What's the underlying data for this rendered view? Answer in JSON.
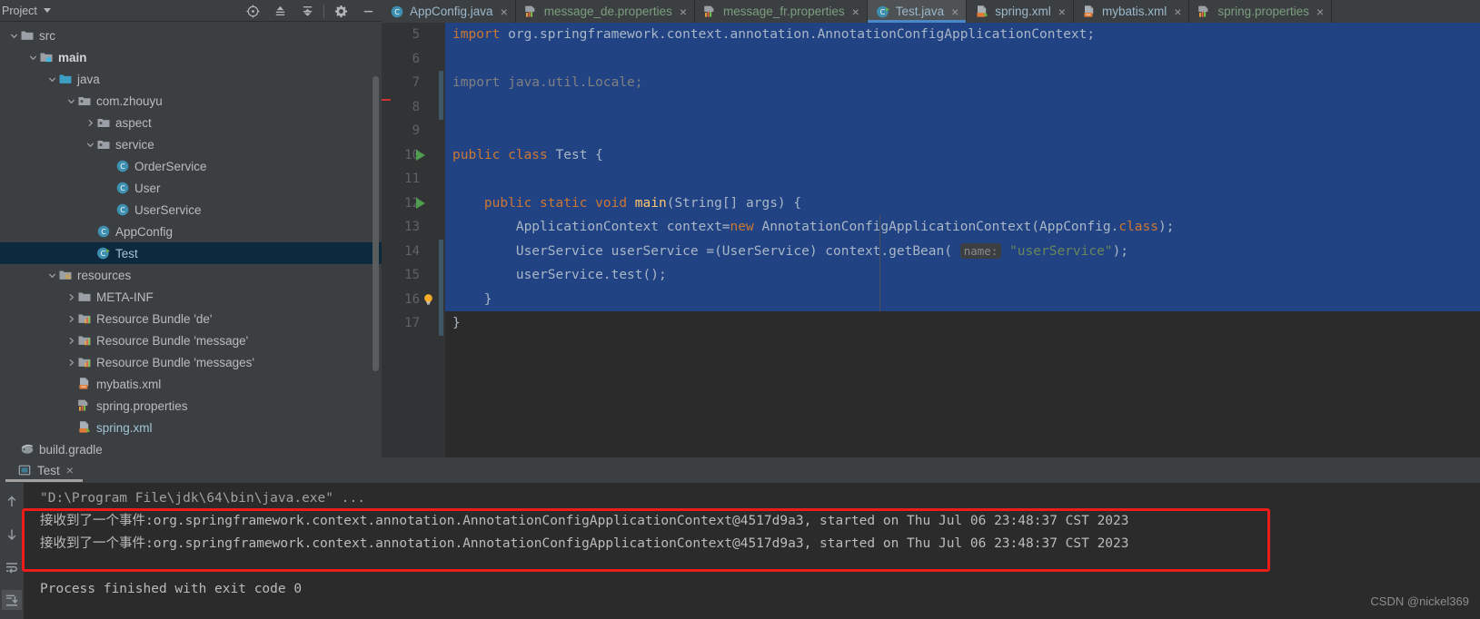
{
  "project_panel": {
    "title": "Project",
    "caret_icon": "chevron-down-icon",
    "toolbar": [
      {
        "name": "locate-target-icon",
        "label": "Select Opened File"
      },
      {
        "name": "expand-all-icon",
        "label": "Expand All"
      },
      {
        "name": "collapse-all-icon",
        "label": "Collapse All"
      },
      {
        "name": "gear-icon",
        "label": "Settings"
      },
      {
        "name": "minimize-icon",
        "label": "Hide"
      }
    ],
    "tree": [
      {
        "label": "src",
        "indent": 0,
        "twisty": "expanded",
        "icon": "folder-icon",
        "style": "normal"
      },
      {
        "label": "main",
        "indent": 1,
        "twisty": "expanded",
        "icon": "module-folder-icon",
        "style": "bold"
      },
      {
        "label": "java",
        "indent": 2,
        "twisty": "expanded",
        "icon": "source-folder-icon",
        "style": "normal"
      },
      {
        "label": "com.zhouyu",
        "indent": 3,
        "twisty": "expanded",
        "icon": "package-icon",
        "style": "normal"
      },
      {
        "label": "aspect",
        "indent": 4,
        "twisty": "collapsed",
        "icon": "package-icon",
        "style": "normal"
      },
      {
        "label": "service",
        "indent": 4,
        "twisty": "expanded",
        "icon": "package-icon",
        "style": "normal"
      },
      {
        "label": "OrderService",
        "indent": 5,
        "twisty": "none",
        "icon": "class-icon",
        "style": "normal"
      },
      {
        "label": "User",
        "indent": 5,
        "twisty": "none",
        "icon": "class-icon",
        "style": "normal"
      },
      {
        "label": "UserService",
        "indent": 5,
        "twisty": "none",
        "icon": "class-icon",
        "style": "normal"
      },
      {
        "label": "AppConfig",
        "indent": 4,
        "twisty": "none",
        "icon": "class-icon",
        "style": "normal"
      },
      {
        "label": "Test",
        "indent": 4,
        "twisty": "none",
        "icon": "runnable-class-icon",
        "style": "selected"
      },
      {
        "label": "resources",
        "indent": 2,
        "twisty": "expanded",
        "icon": "resources-folder-icon",
        "style": "normal"
      },
      {
        "label": "META-INF",
        "indent": 3,
        "twisty": "collapsed",
        "icon": "folder-icon",
        "style": "normal"
      },
      {
        "label": "Resource Bundle 'de'",
        "indent": 3,
        "twisty": "collapsed",
        "icon": "resource-bundle-icon",
        "style": "normal"
      },
      {
        "label": "Resource Bundle 'message'",
        "indent": 3,
        "twisty": "collapsed",
        "icon": "resource-bundle-icon",
        "style": "normal"
      },
      {
        "label": "Resource Bundle 'messages'",
        "indent": 3,
        "twisty": "collapsed",
        "icon": "resource-bundle-icon",
        "style": "normal"
      },
      {
        "label": "mybatis.xml",
        "indent": 3,
        "twisty": "none",
        "icon": "xml-file-icon",
        "style": "normal"
      },
      {
        "label": "spring.properties",
        "indent": 3,
        "twisty": "none",
        "icon": "properties-file-icon",
        "style": "normal"
      },
      {
        "label": "spring.xml",
        "indent": 3,
        "twisty": "none",
        "icon": "spring-xml-icon",
        "style": "open"
      },
      {
        "label": "build.gradle",
        "indent": 0,
        "twisty": "none",
        "icon": "gradle-file-icon",
        "style": "normal"
      }
    ]
  },
  "editor": {
    "tabs": [
      {
        "label": "AppConfig.java",
        "icon": "java-class-icon",
        "active": false,
        "kind": "java"
      },
      {
        "label": "message_de.properties",
        "icon": "properties-file-icon",
        "active": false,
        "kind": "props"
      },
      {
        "label": "message_fr.properties",
        "icon": "properties-file-icon",
        "active": false,
        "kind": "props"
      },
      {
        "label": "Test.java",
        "icon": "runnable-class-icon",
        "active": true,
        "kind": "java"
      },
      {
        "label": "spring.xml",
        "icon": "spring-xml-icon",
        "active": false,
        "kind": "java"
      },
      {
        "label": "mybatis.xml",
        "icon": "xml-file-icon",
        "active": false,
        "kind": "java"
      },
      {
        "label": "spring.properties",
        "icon": "properties-file-icon",
        "active": false,
        "kind": "props"
      }
    ],
    "close_glyph": "×",
    "lines": [
      {
        "num": "5",
        "selected": true,
        "run": false,
        "bulb": false,
        "tokens": [
          {
            "t": "import ",
            "c": "kw"
          },
          {
            "t": "org.springframework.context.annotation.AnnotationConfigApplicationContext;",
            "c": "plain"
          }
        ]
      },
      {
        "num": "6",
        "selected": true,
        "run": false,
        "bulb": false,
        "tokens": []
      },
      {
        "num": "7",
        "selected": true,
        "run": false,
        "bulb": false,
        "tokens": [
          {
            "t": "import java.util.Locale;",
            "c": "cmt"
          }
        ]
      },
      {
        "num": "8",
        "selected": true,
        "run": false,
        "bulb": false,
        "tokens": []
      },
      {
        "num": "9",
        "selected": true,
        "run": false,
        "bulb": false,
        "tokens": []
      },
      {
        "num": "10",
        "selected": true,
        "run": true,
        "bulb": false,
        "tokens": [
          {
            "t": "public class ",
            "c": "kw"
          },
          {
            "t": "Test {",
            "c": "plain"
          }
        ]
      },
      {
        "num": "11",
        "selected": true,
        "run": false,
        "bulb": false,
        "tokens": []
      },
      {
        "num": "12",
        "selected": true,
        "run": true,
        "bulb": false,
        "tokens": [
          {
            "t": "    ",
            "c": "plain"
          },
          {
            "t": "public static void ",
            "c": "kw"
          },
          {
            "t": "main",
            "c": "mth"
          },
          {
            "t": "(String[] args) {",
            "c": "plain"
          }
        ]
      },
      {
        "num": "13",
        "selected": true,
        "run": false,
        "bulb": false,
        "tokens": [
          {
            "t": "        ApplicationContext context=",
            "c": "plain"
          },
          {
            "t": "new ",
            "c": "kw"
          },
          {
            "t": "AnnotationConfigApplicationContext(AppConfig.",
            "c": "plain"
          },
          {
            "t": "class",
            "c": "kw"
          },
          {
            "t": ");",
            "c": "plain"
          }
        ]
      },
      {
        "num": "14",
        "selected": true,
        "run": false,
        "bulb": false,
        "tokens": [
          {
            "t": "        UserService userService =(UserService) context.getBean( ",
            "c": "plain"
          },
          {
            "t": "name:",
            "c": "hint"
          },
          {
            "t": " ",
            "c": "plain"
          },
          {
            "t": "\"userService\"",
            "c": "str"
          },
          {
            "t": ");",
            "c": "plain"
          }
        ]
      },
      {
        "num": "15",
        "selected": true,
        "run": false,
        "bulb": false,
        "tokens": [
          {
            "t": "        userService.test();",
            "c": "plain"
          }
        ]
      },
      {
        "num": "16",
        "selected": true,
        "run": false,
        "bulb": true,
        "tokens": [
          {
            "t": "    }",
            "c": "plain"
          }
        ]
      },
      {
        "num": "17",
        "selected": false,
        "run": false,
        "bulb": false,
        "tokens": [
          {
            "t": "}",
            "c": "plain"
          }
        ]
      }
    ]
  },
  "run_panel": {
    "tab_label": "Test",
    "tab_icon": "console-icon",
    "close_glyph": "×",
    "side_buttons": [
      {
        "name": "up-arrow-icon",
        "label": "Previous Occurrence",
        "active": false
      },
      {
        "name": "down-arrow-icon",
        "label": "Next Occurrence",
        "active": false
      },
      {
        "name": "soft-wrap-icon",
        "label": "Soft-Wrap",
        "active": false
      },
      {
        "name": "scroll-to-end-icon",
        "label": "Scroll to End",
        "active": true
      }
    ],
    "console_lines": [
      {
        "text": "\"D:\\Program File\\jdk\\64\\bin\\java.exe\" ...",
        "dim": true
      },
      {
        "text": "接收到了一个事件:org.springframework.context.annotation.AnnotationConfigApplicationContext@4517d9a3, started on Thu Jul 06 23:48:37 CST 2023",
        "dim": false
      },
      {
        "text": "接收到了一个事件:org.springframework.context.annotation.AnnotationConfigApplicationContext@4517d9a3, started on Thu Jul 06 23:48:37 CST 2023",
        "dim": false
      },
      {
        "text": "",
        "dim": false
      },
      {
        "text": "Process finished with exit code 0",
        "dim": false
      }
    ],
    "highlight_box_color": "#ee1b1b"
  },
  "watermark": "CSDN @nickel369",
  "colors": {
    "panel_bg": "#3c3f41",
    "editor_bg": "#2b2b2b",
    "selection_blue": "#214283",
    "tree_selection": "#0d293e",
    "accent_tab": "#4a88c7",
    "keyword_orange": "#cc7832",
    "string_green": "#6a8759",
    "method_yellow": "#ffc66d",
    "text_gray": "#a9b7c6",
    "highlight_red": "#ee1b1b"
  }
}
